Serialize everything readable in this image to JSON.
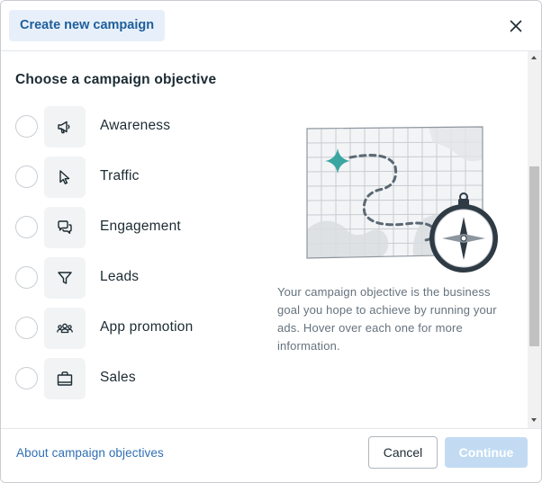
{
  "header": {
    "title": "Create new campaign",
    "close_icon": "close-icon"
  },
  "main": {
    "section_title": "Choose a campaign objective",
    "objectives": [
      {
        "label": "Awareness",
        "icon": "megaphone-icon",
        "selected": false
      },
      {
        "label": "Traffic",
        "icon": "cursor-icon",
        "selected": false
      },
      {
        "label": "Engagement",
        "icon": "chat-bubbles-icon",
        "selected": false
      },
      {
        "label": "Leads",
        "icon": "funnel-icon",
        "selected": false
      },
      {
        "label": "App promotion",
        "icon": "people-icon",
        "selected": false
      },
      {
        "label": "Sales",
        "icon": "shopping-bag-icon",
        "selected": false
      }
    ],
    "illustration_icon": "map-compass-illustration",
    "description": "Your campaign objective is the business goal you hope to achieve by running your ads. Hover over each one for more information."
  },
  "footer": {
    "about_link": "About campaign objectives",
    "cancel_label": "Cancel",
    "continue_label": "Continue"
  },
  "colors": {
    "accent": "#1f5e9b",
    "title_chip_bg": "#e7f0fa",
    "link": "#2f6fb3",
    "continue_disabled_bg": "#c2dbf3",
    "map_marker": "#3aa6a0"
  }
}
